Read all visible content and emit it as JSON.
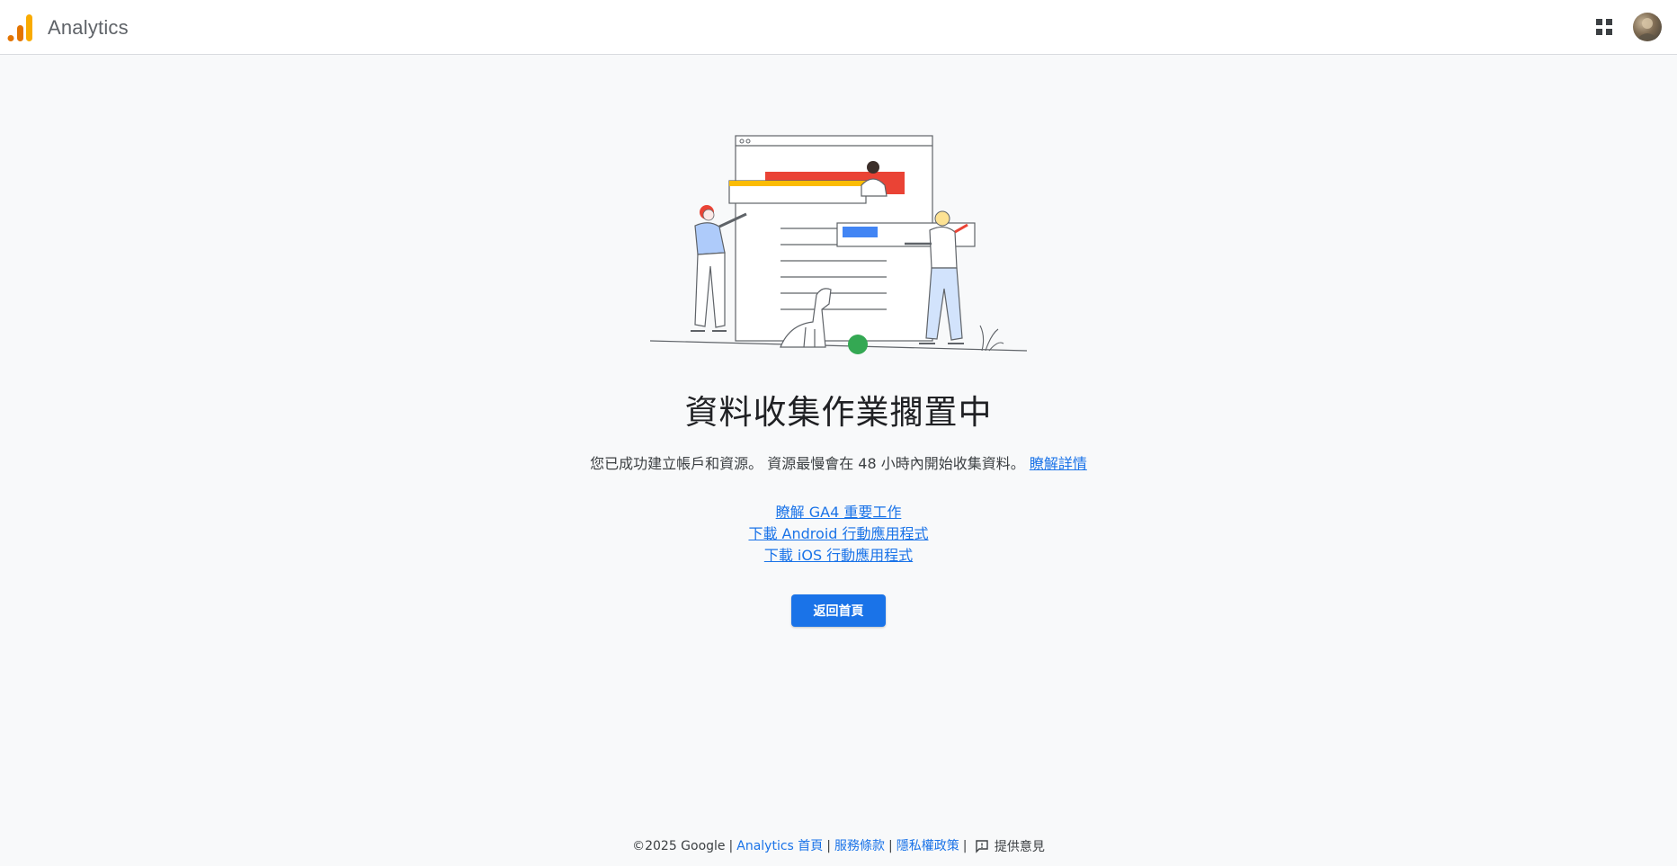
{
  "header": {
    "app_name": "Analytics",
    "logo_icon": "analytics-logo-icon",
    "apps_icon": "apps-grid-icon",
    "avatar_icon": "account-avatar"
  },
  "main": {
    "heading": "資料收集作業擱置中",
    "description": "您已成功建立帳戶和資源。 資源最慢會在 48 小時內開始收集資料。",
    "learn_more": "瞭解詳情",
    "links": [
      "瞭解 GA4 重要工作",
      "下載 Android 行動應用程式",
      "下載 iOS 行動應用程式"
    ],
    "home_button": "返回首頁"
  },
  "footer": {
    "copyright": "©2025 Google",
    "links": [
      "Analytics 首頁",
      "服務條款",
      "隱私權政策"
    ],
    "feedback": "提供意見",
    "feedback_icon": "feedback-icon"
  },
  "colors": {
    "accent": "#1a73e8",
    "logo_orange": "#f9ab00",
    "logo_dark_orange": "#e37400",
    "illustration_red": "#ea4335",
    "illustration_yellow": "#fbbc04",
    "illustration_blue": "#4285f4",
    "illustration_green": "#34a853"
  }
}
